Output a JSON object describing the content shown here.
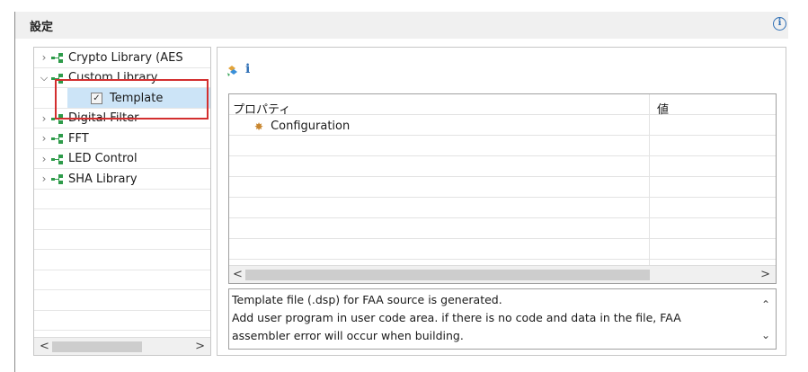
{
  "header": {
    "title": "設定"
  },
  "tree": {
    "items": [
      {
        "label": "Crypto Library (AES",
        "expanded": false,
        "icon": "library-icon"
      },
      {
        "label": "Custom Library",
        "expanded": true,
        "icon": "library-icon"
      },
      {
        "label": "Template",
        "child": true,
        "selected": true,
        "icon": "checkbox-icon"
      },
      {
        "label": "Digital Filter",
        "expanded": false,
        "icon": "library-icon"
      },
      {
        "label": "FFT",
        "expanded": false,
        "icon": "library-icon"
      },
      {
        "label": "LED Control",
        "expanded": false,
        "icon": "library-icon"
      },
      {
        "label": "SHA Library",
        "expanded": false,
        "icon": "library-icon"
      }
    ]
  },
  "properties": {
    "columns": {
      "property": "プロパティ",
      "value": "値"
    },
    "rows": [
      {
        "label": "Configuration",
        "icon": "gear-icon"
      }
    ]
  },
  "description": {
    "lines": [
      "Template file (.dsp) for FAA source is generated.",
      "Add user program in user code area. if there is no code and data in the file, FAA",
      "assembler error will occur when building."
    ]
  },
  "colors": {
    "highlight": "#d32f2f",
    "selection": "#cce4f7",
    "library_icon": "#2e9b4a"
  }
}
